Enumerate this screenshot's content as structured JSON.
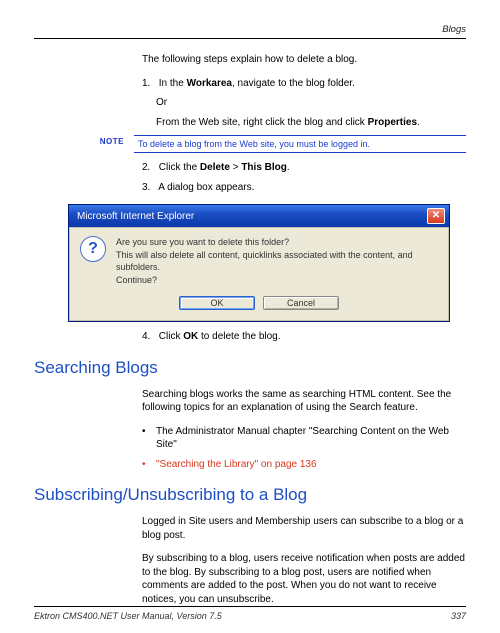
{
  "header": {
    "section": "Blogs"
  },
  "intro": "The following steps explain how to delete a blog.",
  "steps": {
    "s1_num": "1.",
    "s1_a": "In the ",
    "s1_bold1": "Workarea",
    "s1_b": ", navigate to the blog folder.",
    "s1_or": "Or",
    "s1_c": "From the Web site, right click the blog and click ",
    "s1_bold2": "Properties",
    "s1_d": ".",
    "s2_num": "2.",
    "s2_a": "Click the ",
    "s2_bold1": "Delete",
    "s2_gt": " > ",
    "s2_bold2": "This Blog",
    "s2_b": ".",
    "s3_num": "3.",
    "s3": "A dialog box appears.",
    "s4_num": "4.",
    "s4_a": "Click ",
    "s4_bold": "OK",
    "s4_b": " to delete the blog."
  },
  "note": {
    "label": "NOTE",
    "text": "To delete a blog from the Web site, you must be logged in."
  },
  "dialog": {
    "title": "Microsoft Internet Explorer",
    "line1": "Are you sure you want to delete this folder?",
    "line2": "This will also delete all content, quicklinks associated with the content, and subfolders.",
    "line3": "Continue?",
    "ok": "OK",
    "cancel": "Cancel",
    "close_glyph": "✕"
  },
  "sections": {
    "search_h": "Searching Blogs",
    "search_p": "Searching blogs works the same as searching HTML content. See the following topics for an explanation of using the Search feature.",
    "search_b1": "The Administrator Manual chapter \"Searching Content on the Web Site\"",
    "search_b2": "\"Searching the Library\" on page 136",
    "sub_h": "Subscribing/Unsubscribing to a Blog",
    "sub_p1": "Logged in Site users and Membership users can subscribe to a blog or a blog post.",
    "sub_p2": "By subscribing to a blog, users receive notification when posts are added to the blog. By subscribing to a blog post, users are notified when comments are added to the post. When you do not want to receive notices, you can unsubscribe."
  },
  "footer": {
    "left": "Ektron CMS400.NET User Manual, Version 7.5",
    "right": "337"
  }
}
